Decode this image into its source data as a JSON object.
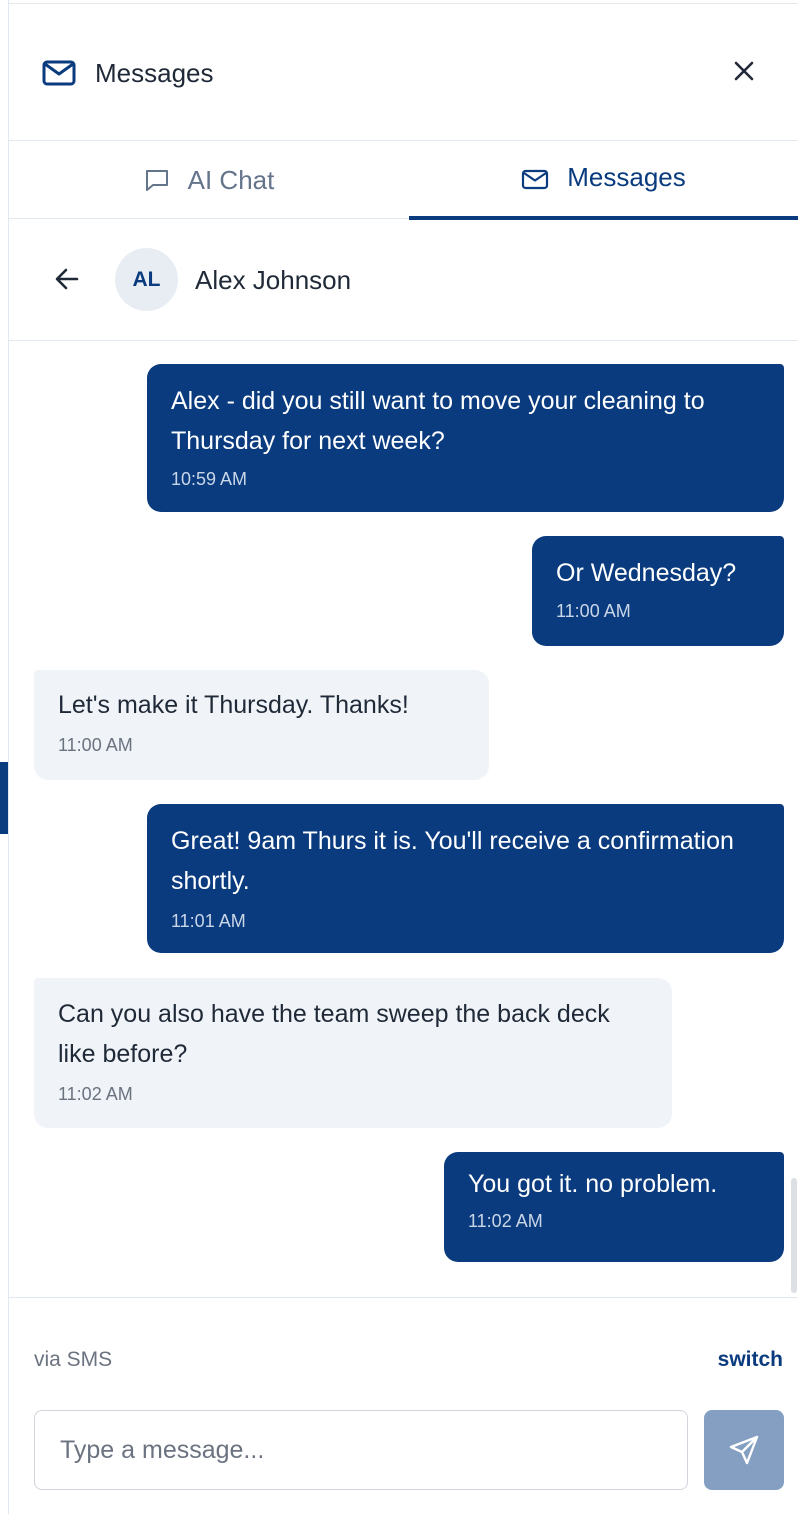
{
  "panel": {
    "title": "Messages",
    "icon": "mail-icon",
    "close_icon": "close-icon"
  },
  "tabs": [
    {
      "label": "AI Chat",
      "icon": "chat-bubble-icon",
      "active": false
    },
    {
      "label": "Messages",
      "icon": "mail-icon",
      "active": true
    }
  ],
  "contact": {
    "initials": "AL",
    "name": "Alex Johnson",
    "back_icon": "arrow-left-icon"
  },
  "messages": [
    {
      "direction": "outgoing",
      "text": "Alex - did you still want to move your cleaning to Thursday for next week?",
      "time": "10:59 AM"
    },
    {
      "direction": "outgoing",
      "text": "Or Wednesday?",
      "time": "11:00 AM"
    },
    {
      "direction": "incoming",
      "text": "Let's make it Thursday. Thanks!",
      "time": "11:00 AM"
    },
    {
      "direction": "outgoing",
      "text": "Great! 9am Thurs it is. You'll receive a confirmation shortly.",
      "time": "11:01 AM"
    },
    {
      "direction": "incoming",
      "text": "Can you also have the team sweep the back deck like before?",
      "time": "11:02 AM"
    },
    {
      "direction": "outgoing",
      "text": "You got it. no problem.",
      "time": "11:02 AM"
    }
  ],
  "composer": {
    "channel_label": "via SMS",
    "switch_label": "switch",
    "placeholder": "Type a message...",
    "value": "",
    "send_icon": "send-icon"
  },
  "colors": {
    "brand": "#0a3b7e",
    "incoming_bubble": "#f0f4f8",
    "send_button_disabled": "#849fc2",
    "divider": "#e2e8f0"
  }
}
